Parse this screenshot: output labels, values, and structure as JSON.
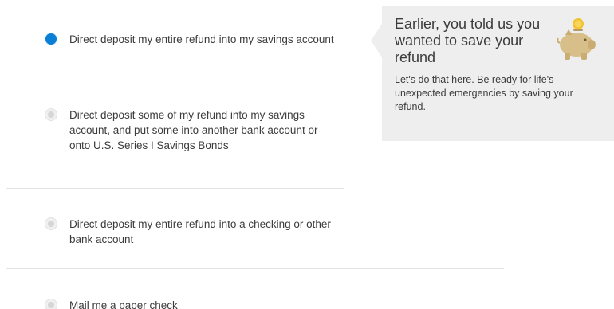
{
  "options": [
    {
      "label": "Direct deposit my entire refund into my savings account",
      "selected": true
    },
    {
      "label": "Direct deposit some of my refund into my savings account, and put some into another bank account or onto U.S. Series I Savings Bonds",
      "selected": false
    },
    {
      "label": "Direct deposit my entire refund into a checking or other bank account",
      "selected": false
    },
    {
      "label": "Mail me a paper check",
      "selected": false
    }
  ],
  "tip": {
    "title": "Earlier, you told us you wanted to save your refund",
    "body": "Let's do that here. Be ready for life's unexpected emergencies by saving your refund.",
    "icon": "piggy-bank-icon"
  },
  "colors": {
    "accent": "#0a7fd6",
    "tip_background": "#eeeeee",
    "divider": "#e4e4e4",
    "text": "#3c3c3c",
    "coin": "#f2c230",
    "piggy": "#d8bf8a"
  }
}
